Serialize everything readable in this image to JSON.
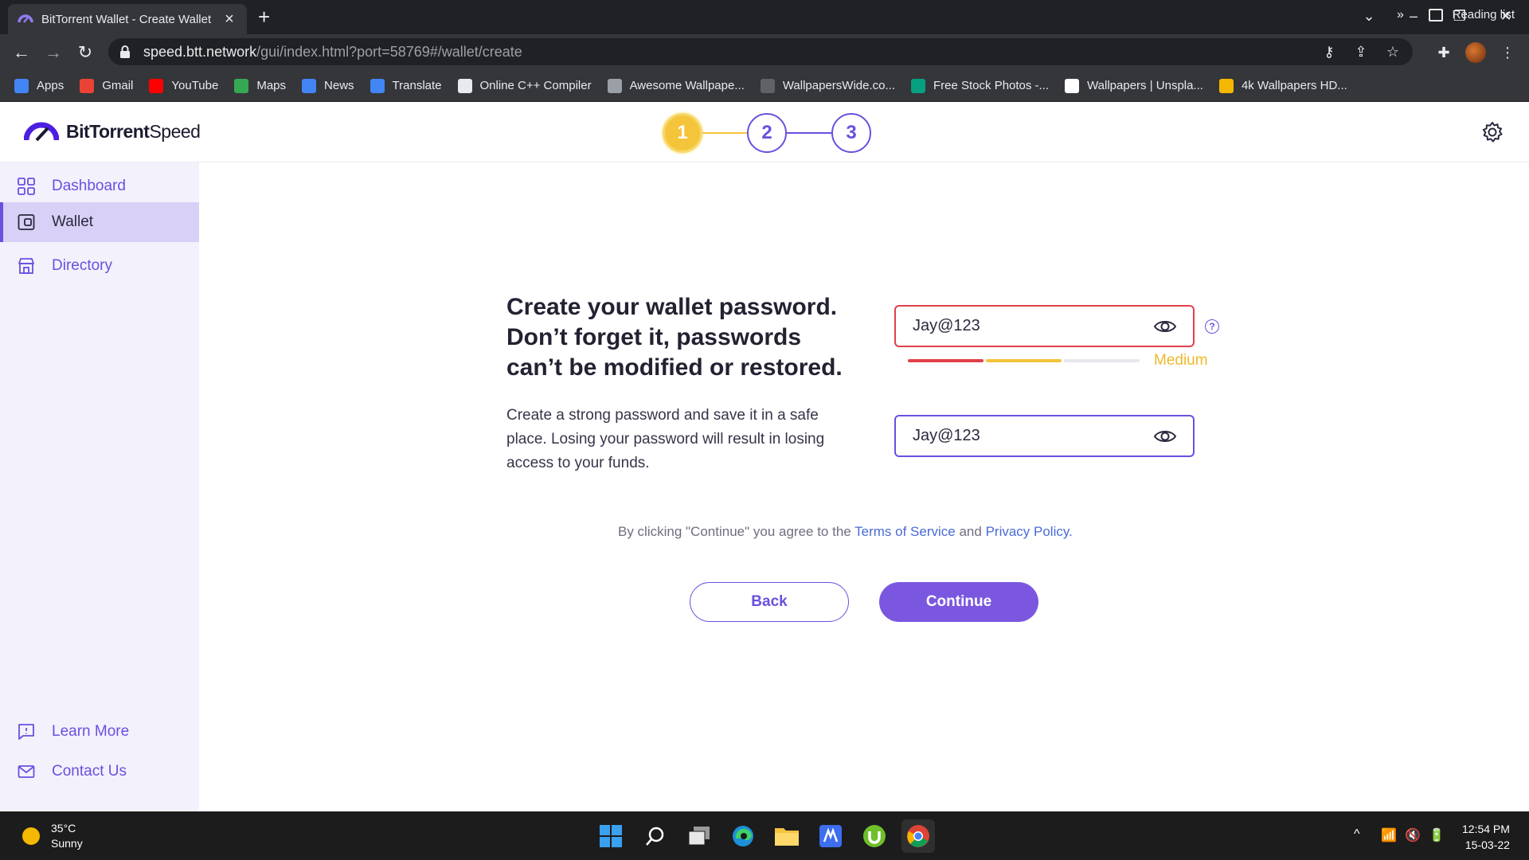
{
  "browser": {
    "tab_title": "BitTorrent Wallet - Create Wallet",
    "url_host": "speed.btt.network",
    "url_path": "/gui/index.html?port=58769#/wallet/create",
    "bookmarks": [
      {
        "label": "Apps",
        "icon": "apps-grid-icon",
        "color": "#4285f4"
      },
      {
        "label": "Gmail",
        "icon": "gmail-icon",
        "color": "#ea4335"
      },
      {
        "label": "YouTube",
        "icon": "youtube-icon",
        "color": "#ff0000"
      },
      {
        "label": "Maps",
        "icon": "maps-icon",
        "color": "#34a853"
      },
      {
        "label": "News",
        "icon": "news-icon",
        "color": "#4285f4"
      },
      {
        "label": "Translate",
        "icon": "translate-icon",
        "color": "#4285f4"
      },
      {
        "label": "Online C++ Compiler",
        "icon": "globe-icon",
        "color": "#e8eaed"
      },
      {
        "label": "Awesome Wallpape...",
        "icon": "awesome-wallpapers-icon",
        "color": "#9aa0a6"
      },
      {
        "label": "WallpapersWide.co...",
        "icon": "wallpaperswide-icon",
        "color": "#5f6368"
      },
      {
        "label": "Free Stock Photos -...",
        "icon": "stock-photos-icon",
        "color": "#05a081"
      },
      {
        "label": "Wallpapers | Unspla...",
        "icon": "unsplash-icon",
        "color": "#ffffff"
      },
      {
        "label": "4k Wallpapers HD...",
        "icon": "4k-wallpapers-icon",
        "color": "#f5b800"
      }
    ],
    "bookmarks_more": "»",
    "reading_list": "Reading list"
  },
  "app": {
    "brand_bold": "BitTorrent",
    "brand_light": " Speed",
    "steps": [
      "1",
      "2",
      "3"
    ],
    "active_step": 1,
    "sidebar": {
      "top_items": [
        {
          "label": "Dashboard",
          "icon": "dashboard-icon"
        },
        {
          "label": "Wallet",
          "icon": "wallet-icon",
          "active": true
        },
        {
          "label": "Directory",
          "icon": "directory-icon"
        }
      ],
      "bottom_items": [
        {
          "label": "Learn More",
          "icon": "learn-more-icon"
        },
        {
          "label": "Contact Us",
          "icon": "mail-icon"
        }
      ]
    },
    "form": {
      "headline": "Create your wallet password. Don’t forget it, passwords can’t be modified or restored.",
      "description": "Create a strong password and save it in a safe place. Losing your password will result in losing access to your funds.",
      "password_value": "Jay@123",
      "confirm_value": "Jay@123",
      "strength_label": "Medium",
      "strength_level": 2,
      "strength_max": 3,
      "agree_prefix": "By clicking \"Continue\" you agree to the ",
      "terms_link": "Terms of Service",
      "agree_and": " and ",
      "privacy_link": "Privacy Policy",
      "agree_suffix": ".",
      "back_label": "Back",
      "continue_label": "Continue"
    },
    "colors": {
      "accent": "#6b4fe0",
      "step_active": "#f4c43a",
      "error": "#e0414a",
      "medium": "#eeb92a",
      "link": "#4a6ad6"
    }
  },
  "taskbar": {
    "temperature": "35°C",
    "condition": "Sunny",
    "time": "12:54 PM",
    "date": "15-03-22"
  }
}
